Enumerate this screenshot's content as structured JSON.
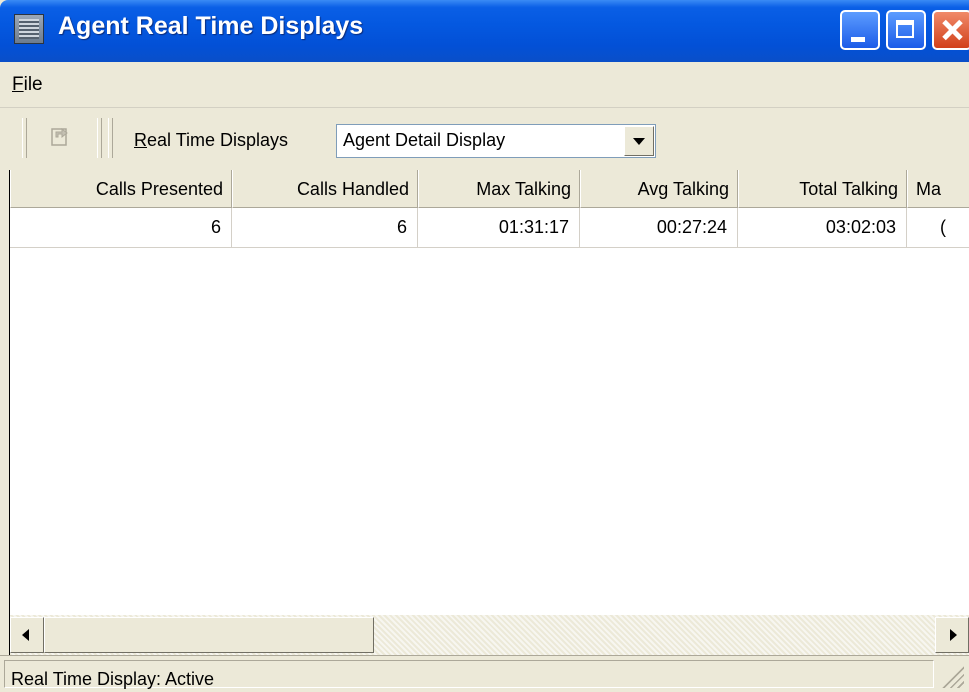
{
  "window": {
    "title": "Agent Real Time Displays"
  },
  "menu": {
    "file_label_first": "F",
    "file_label_rest": "ile"
  },
  "toolbar": {
    "rtd_label_first": "R",
    "rtd_label_rest": "eal Time Displays",
    "selected_display": "Agent Detail Display"
  },
  "table": {
    "columns": [
      "Calls Presented",
      "Calls Handled",
      "Max Talking",
      "Avg Talking",
      "Total Talking",
      "Ma"
    ],
    "rows": [
      [
        "6",
        "6",
        "01:31:17",
        "00:27:24",
        "03:02:03",
        "("
      ]
    ]
  },
  "status": {
    "text": "Real Time Display: Active"
  },
  "icons": [
    "app-icon",
    "minimize-icon",
    "maximize-icon",
    "close-icon",
    "toolbar-export-icon",
    "dropdown-arrow-icon",
    "scroll-left-icon",
    "scroll-right-icon",
    "resize-grip-icon"
  ]
}
